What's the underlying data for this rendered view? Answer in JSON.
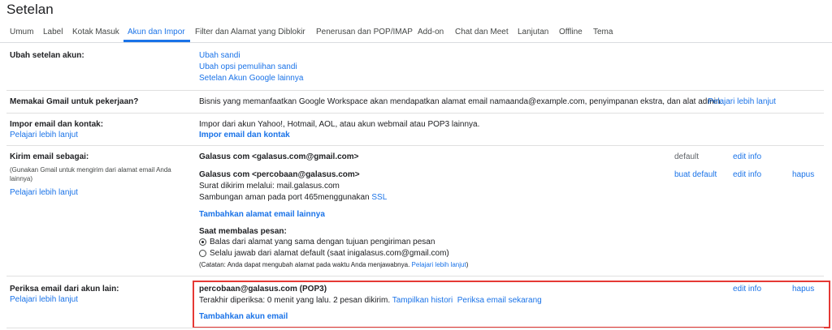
{
  "page_title": "Setelan",
  "tabs": [
    {
      "label": "Umum"
    },
    {
      "label": "Label"
    },
    {
      "label": "Kotak Masuk"
    },
    {
      "label": "Akun dan Impor"
    },
    {
      "label": "Filter dan Alamat yang Diblokir"
    },
    {
      "label": "Penerusan dan POP/IMAP"
    },
    {
      "label": "Add-on"
    },
    {
      "label": "Chat dan Meet"
    },
    {
      "label": "Lanjutan"
    },
    {
      "label": "Offline"
    },
    {
      "label": "Tema"
    }
  ],
  "active_tab": "Akun dan Impor",
  "sections": {
    "change_account": {
      "label": "Ubah setelan akun:",
      "links": [
        "Ubah sandi",
        "Ubah opsi pemulihan sandi",
        "Setelan Akun Google lainnya"
      ]
    },
    "gmail_work": {
      "label": "Memakai Gmail untuk pekerjaan?",
      "text": "Bisnis yang memanfaatkan Google Workspace akan mendapatkan alamat email namaanda@example.com, penyimpanan ekstra, dan alat admin.",
      "link": "Pelajari lebih lanjut"
    },
    "import": {
      "label": "Impor email dan kontak:",
      "learn_more": "Pelajari lebih lanjut",
      "text": "Impor dari akun Yahoo!, Hotmail, AOL, atau akun webmail atau POP3 lainnya.",
      "action": "Impor email dan kontak"
    },
    "send_as": {
      "label": "Kirim email sebagai:",
      "desc": "(Gunakan Gmail untuk mengirim dari alamat email Anda lainnya)",
      "learn_more": "Pelajari lebih lanjut",
      "accounts": [
        {
          "name": "Galasus com <galasus.com@gmail.com>",
          "status": "default",
          "edit": "edit info"
        },
        {
          "name": "Galasus com <percobaan@galasus.com>",
          "status": "buat default",
          "edit": "edit info",
          "delete": "hapus",
          "detail1": "Surat dikirim melalui: mail.galasus.com",
          "detail2": "Sambungan aman pada port 465menggunakan",
          "detail2_link": "SSL"
        }
      ],
      "add_another": "Tambahkan alamat email lainnya",
      "reply_heading": "Saat membalas pesan:",
      "reply_options": [
        {
          "label": "Balas dari alamat yang sama dengan tujuan pengiriman pesan",
          "checked": true
        },
        {
          "label": "Selalu jawab dari alamat default (saat inigalasus.com@gmail.com)",
          "checked": false
        }
      ],
      "note": "(Catatan: Anda dapat mengubah alamat pada waktu Anda menjawabnya.",
      "note_link": "Pelajari lebih lanjut",
      "note_end": ")"
    },
    "check_mail": {
      "label": "Periksa email dari akun lain:",
      "learn_more": "Pelajari lebih lanjut",
      "account": "percobaan@galasus.com (POP3)",
      "edit": "edit info",
      "delete": "hapus",
      "last_checked": "Terakhir diperiksa: 0 menit yang lalu. 2 pesan dikirim.",
      "history_link": "Tampilkan histori",
      "check_now_link": "Periksa email sekarang",
      "add_account": "Tambahkan akun email"
    }
  },
  "colors": {
    "accent": "#1a73e8",
    "highlight_border": "#e53935"
  }
}
